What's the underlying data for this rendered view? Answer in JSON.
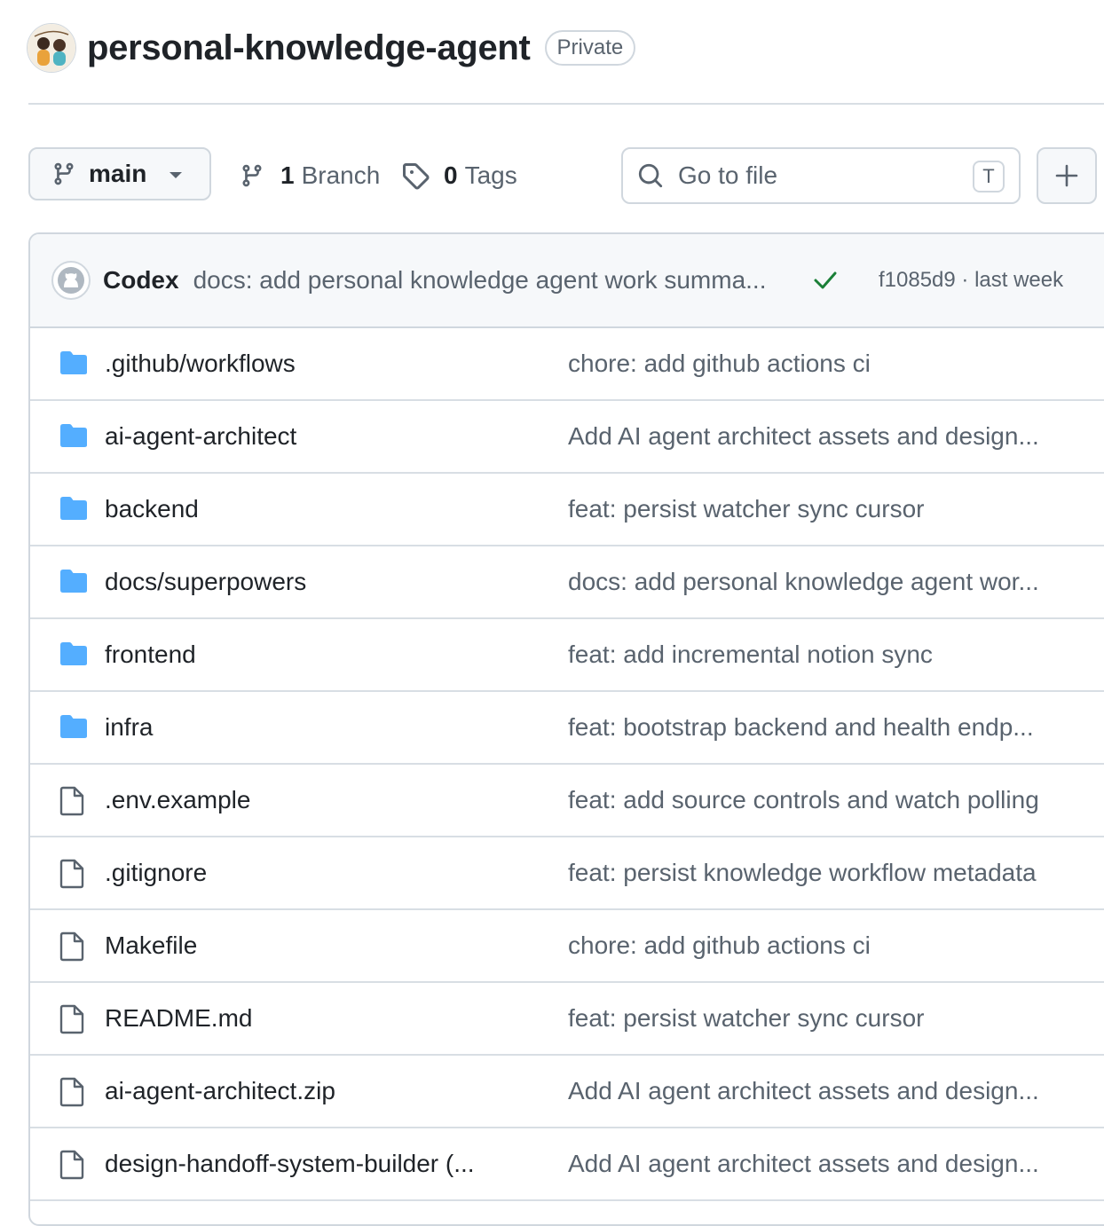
{
  "repo": {
    "name": "personal-knowledge-agent",
    "visibility": "Private"
  },
  "toolbar": {
    "branch": "main",
    "branch_count": "1",
    "branch_label": "Branch",
    "tag_count": "0",
    "tag_label": "Tags",
    "search_placeholder": "Go to file",
    "search_shortcut": "T"
  },
  "latest_commit": {
    "author": "Codex",
    "message": "docs: add personal knowledge agent work summa...",
    "status": "success",
    "meta": "f1085d9 · last week"
  },
  "files": [
    {
      "type": "folder",
      "name": ".github/workflows",
      "message": "chore: add github actions ci"
    },
    {
      "type": "folder",
      "name": "ai-agent-architect",
      "message": "Add AI agent architect assets and design..."
    },
    {
      "type": "folder",
      "name": "backend",
      "message": "feat: persist watcher sync cursor"
    },
    {
      "type": "folder",
      "name": "docs/superpowers",
      "message": "docs: add personal knowledge agent wor..."
    },
    {
      "type": "folder",
      "name": "frontend",
      "message": "feat: add incremental notion sync"
    },
    {
      "type": "folder",
      "name": "infra",
      "message": "feat: bootstrap backend and health endp..."
    },
    {
      "type": "file",
      "name": ".env.example",
      "message": "feat: add source controls and watch polling"
    },
    {
      "type": "file",
      "name": ".gitignore",
      "message": "feat: persist knowledge workflow metadata"
    },
    {
      "type": "file",
      "name": "Makefile",
      "message": "chore: add github actions ci"
    },
    {
      "type": "file",
      "name": "README.md",
      "message": "feat: persist watcher sync cursor"
    },
    {
      "type": "file",
      "name": "ai-agent-architect.zip",
      "message": "Add AI agent architect assets and design..."
    },
    {
      "type": "file",
      "name": "design-handoff-system-builder (...",
      "message": "Add AI agent architect assets and design..."
    }
  ],
  "colors": {
    "folder": "#54aeff",
    "check": "#1a7f37",
    "border": "#d0d7de"
  }
}
